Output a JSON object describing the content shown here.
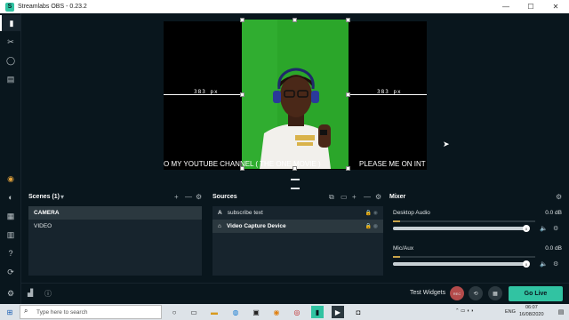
{
  "window": {
    "title": "Streamlabs OBS - 0.23.2",
    "minimize": "—",
    "maximize": "☐",
    "close": "✕"
  },
  "preview": {
    "dim_left": "383 px",
    "dim_right": "383 px",
    "ticker_left": "O MY YOUTUBE CHANNEL ( THE ONE MOVIE )",
    "ticker_right": "PLEASE ME ON INT"
  },
  "scenes": {
    "title": "Scenes (1)",
    "items": [
      {
        "label": "CAMERA"
      },
      {
        "label": "VIDEO"
      }
    ]
  },
  "sources": {
    "title": "Sources",
    "items": [
      {
        "icon": "A",
        "label": "subscribe text"
      },
      {
        "icon": "⌂",
        "label": "Video Capture Device"
      }
    ]
  },
  "mixer": {
    "title": "Mixer",
    "items": [
      {
        "name": "Desktop Audio",
        "db": "0.0 dB",
        "level": 0.05,
        "volume": 1.0
      },
      {
        "name": "Mic/Aux",
        "db": "0.0 dB",
        "level": 0.05,
        "volume": 1.0
      }
    ]
  },
  "footer": {
    "test_widgets": "Test Widgets",
    "go_live": "Go Live",
    "rec": "REC"
  },
  "taskbar": {
    "search_placeholder": "Type here to search",
    "lang": "ENG",
    "time": "06:07",
    "date": "16/08/2020"
  },
  "colors": {
    "accent": "#31c3a2",
    "bg": "#09161d",
    "panel": "#17242d",
    "green_screen": "#2ba62a"
  }
}
